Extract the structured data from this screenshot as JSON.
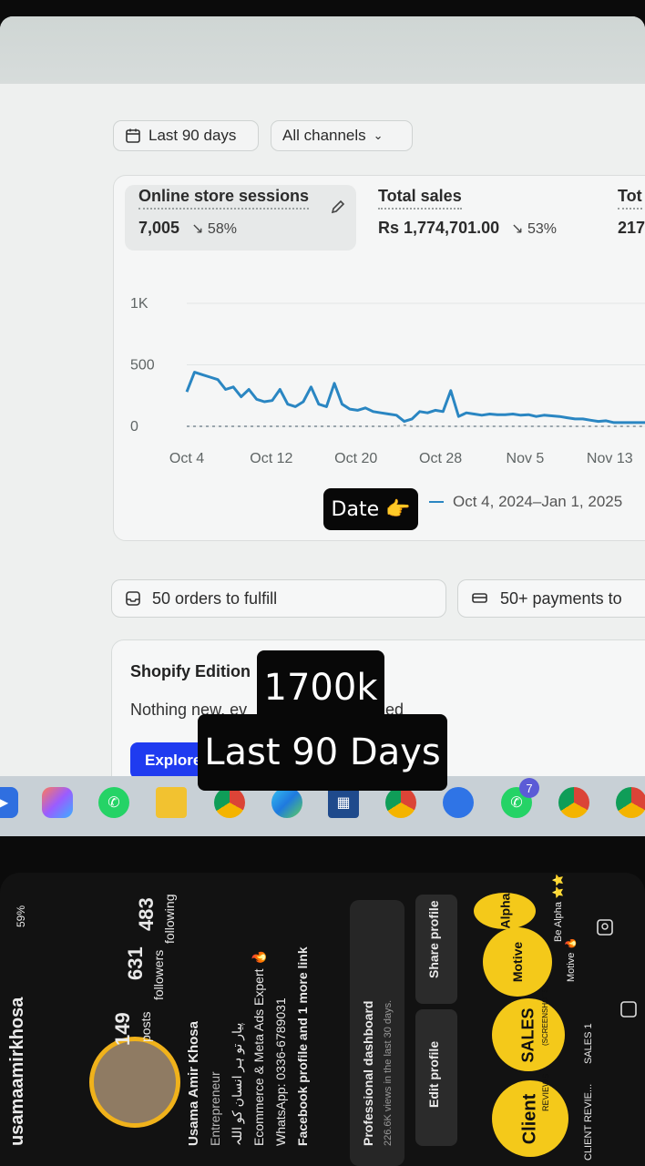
{
  "filters": {
    "date_range": "Last 90 days",
    "channels": "All channels"
  },
  "metrics": [
    {
      "title": "Online store sessions",
      "value": "7,005",
      "delta": "58%"
    },
    {
      "title": "Total sales",
      "value": "Rs 1,774,701.00",
      "delta": "53%"
    },
    {
      "title": "Tot",
      "value": "217"
    }
  ],
  "chart_data": {
    "type": "line",
    "y_ticks": [
      "1K",
      "500",
      "0"
    ],
    "x_ticks": [
      "Oct 4",
      "Oct 12",
      "Oct 20",
      "Oct 28",
      "Nov 5",
      "Nov 13"
    ],
    "ylim": [
      0,
      1000
    ],
    "legend": "Oct 4, 2024–Jan 1, 2025",
    "series": [
      {
        "values": [
          280,
          440,
          420,
          400,
          380,
          300,
          320,
          240,
          300,
          220,
          200,
          210,
          300,
          180,
          160,
          200,
          320,
          180,
          160,
          350,
          180,
          140,
          130,
          150,
          120,
          110,
          100,
          90,
          40,
          60,
          120,
          110,
          130,
          120,
          290,
          80,
          110,
          100,
          90,
          100,
          95,
          95,
          100,
          90,
          95,
          80,
          90,
          85,
          80,
          70,
          60,
          60,
          50,
          40,
          45,
          30,
          30,
          30,
          30,
          30,
          30,
          30
        ],
        "color": "#2a86c2"
      },
      {
        "values": [
          0,
          0,
          0,
          0,
          0,
          0,
          0,
          0,
          0,
          0,
          0,
          0,
          0,
          0,
          0,
          0,
          0,
          0,
          0,
          0,
          0,
          0,
          0,
          0,
          0,
          0,
          0,
          0,
          10,
          0,
          0,
          0,
          0,
          0,
          0,
          0,
          0,
          0,
          0,
          0,
          0,
          0,
          0,
          0,
          0,
          0,
          0,
          0,
          0,
          0,
          0,
          0,
          0,
          0,
          0,
          0,
          0,
          0,
          0,
          0,
          0,
          0
        ],
        "color": "#9aa6ad"
      }
    ]
  },
  "actions": {
    "orders": "50 orders to fulfill",
    "payments": "50+ payments to"
  },
  "editions": {
    "title": "Shopify Edition",
    "text": "Nothing new, ev",
    "text_tail": "ed",
    "button": "Explore"
  },
  "taskbar": {
    "whatsapp_badge": "7"
  },
  "overlays": {
    "date_sticker": "Date 👉",
    "big1": "1700k",
    "big2": "Last 90 Days"
  },
  "phone": {
    "username": "usamaamirkhosa",
    "battery": "59%",
    "stats": [
      {
        "value": "149",
        "label": "posts"
      },
      {
        "value": "631",
        "label": "followers"
      },
      {
        "value": "483",
        "label": "following"
      }
    ],
    "name": "Usama Amir Khosa",
    "role": "Entrepreneur",
    "bio_urdu": "پیار تو ہر انسان کو اللہ",
    "bio_line": "Ecommerce & Meta Ads Expert 🔥",
    "whatsapp": "WhatsApp: 0336-6789031",
    "link": "Facebook profile and 1 more link",
    "dashboard_title": "Professional dashboard",
    "dashboard_sub": "226.6K views in the last 30 days.",
    "edit_profile": "Edit profile",
    "share_profile": "Share profile",
    "highlights": [
      "Client",
      "SALES",
      "Motive",
      "Alpha"
    ],
    "highlight_labels": [
      "CLIENT REVIE...",
      "SALES 1",
      "Motive 🔥",
      "Be Alpha ⭐⭐ Pro"
    ],
    "client_sub": "REVIEWS",
    "sales_sub": "(SCREENSHOTS)"
  }
}
